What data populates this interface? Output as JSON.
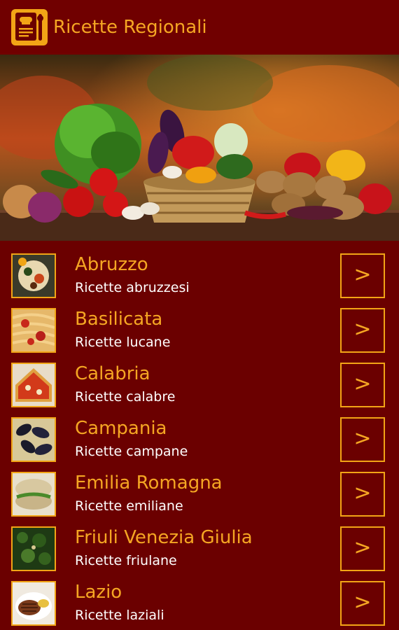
{
  "app": {
    "title": "Ricette Regionali",
    "icon": "recipe-book-icon"
  },
  "colors": {
    "background": "#6b0000",
    "accent": "#f5a623",
    "text": "#ffffff"
  },
  "regions": [
    {
      "name": "Abruzzo",
      "subtitle": "Ricette abruzzesi",
      "button": ">",
      "thumb": "mixed-dish-photo"
    },
    {
      "name": "Basilicata",
      "subtitle": "Ricette lucane",
      "button": ">",
      "thumb": "pasta-photo"
    },
    {
      "name": "Calabria",
      "subtitle": "Ricette calabre",
      "button": ">",
      "thumb": "pizza-photo"
    },
    {
      "name": "Campania",
      "subtitle": "Ricette campane",
      "button": ">",
      "thumb": "mussels-photo"
    },
    {
      "name": "Emilia Romagna",
      "subtitle": "Ricette emiliane",
      "button": ">",
      "thumb": "piadina-photo"
    },
    {
      "name": "Friuli Venezia Giulia",
      "subtitle": "Ricette friulane",
      "button": ">",
      "thumb": "greens-photo"
    },
    {
      "name": "Lazio",
      "subtitle": "Ricette laziali",
      "button": ">",
      "thumb": "meat-photo"
    }
  ]
}
